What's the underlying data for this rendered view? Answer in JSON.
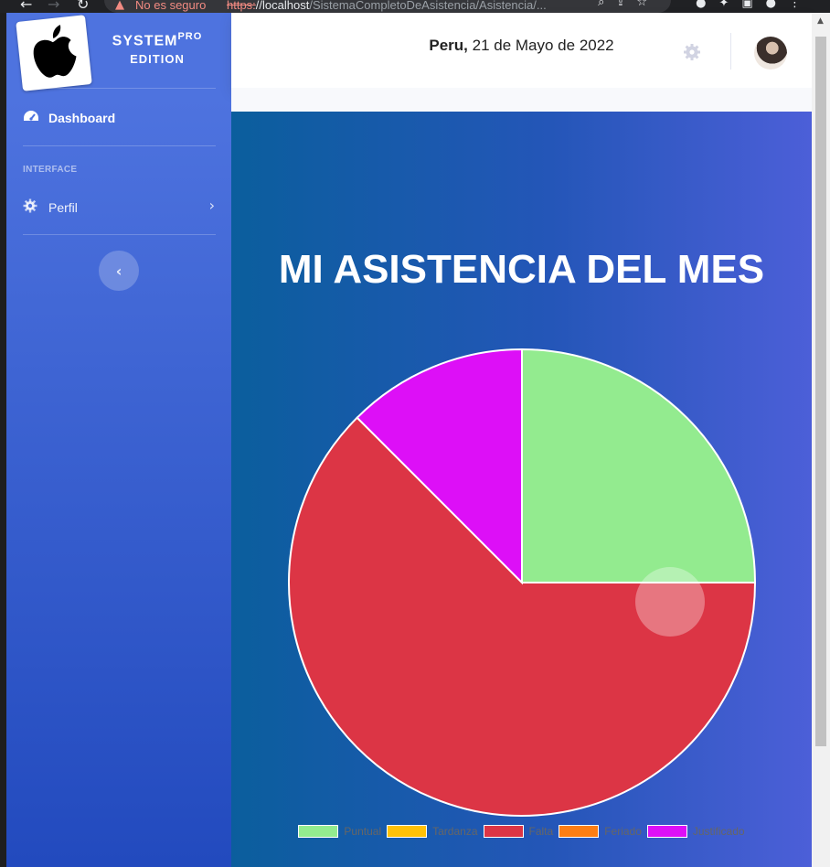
{
  "browser": {
    "security_label": "No es seguro",
    "url_scheme": "https:",
    "url_host": "//localhost",
    "url_path": "/SistemaCompletoDeAsistencia/Asistencia/..."
  },
  "sidebar": {
    "brand_line1": "SYSTEM",
    "brand_sup": "PRO",
    "brand_line2": "EDITION",
    "nav": {
      "dashboard": "Dashboard",
      "section_heading": "INTERFACE",
      "perfil": "Perfil"
    }
  },
  "topbar": {
    "country": "Peru,",
    "date": "21 de Mayo de 2022"
  },
  "main": {
    "title": "MI ASISTENCIA DEL MES"
  },
  "colors": {
    "puntual": "#93eb8f",
    "tardanza": "#ffc107",
    "falta": "#dc3545",
    "feriado": "#fd7e14",
    "justificado": "#dd0ff7"
  },
  "chart_data": {
    "type": "pie",
    "title": "MI ASISTENCIA DEL MES",
    "categories": [
      "Puntual",
      "Tardanza",
      "Falta",
      "Feriado",
      "Justificado"
    ],
    "values": [
      2,
      0,
      5,
      0,
      1
    ],
    "colors": [
      "#93eb8f",
      "#ffc107",
      "#dc3545",
      "#fd7e14",
      "#dd0ff7"
    ],
    "legend_position": "bottom"
  }
}
